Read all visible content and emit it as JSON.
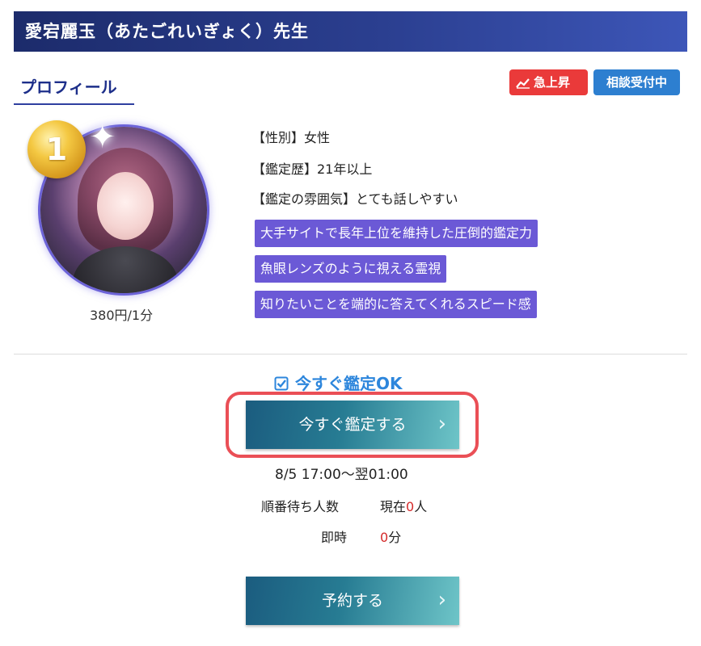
{
  "header": {
    "title": "愛宕麗玉（あたごれいぎょく）先生"
  },
  "profile": {
    "heading": "プロフィール"
  },
  "badges": {
    "rising": "急上昇",
    "accepting": "相談受付中"
  },
  "rank": {
    "number": "1"
  },
  "price": "380円/1分",
  "details": {
    "gender": "【性別】女性",
    "years": "【鑑定歴】21年以上",
    "mood": "【鑑定の雰囲気】とても話しやすい"
  },
  "tags": [
    "大手サイトで長年上位を維持した圧倒的鑑定力",
    "魚眼レンズのように視える霊視",
    "知りたいことを端的に答えてくれるスピード感"
  ],
  "availability": {
    "status": "今すぐ鑑定OK",
    "consult_button": "今すぐ鑑定する",
    "hours": "8/5 17:00〜翌01:00",
    "queue_label": "順番待ち人数",
    "queue_prefix": "現在",
    "queue_count": "0",
    "queue_suffix": "人",
    "wait_label": "即時",
    "wait_count": "0",
    "wait_suffix": "分"
  },
  "reserve_button": "予約する",
  "colors": {
    "header": "#2b3f90",
    "tag": "#6b59d6",
    "rising_badge": "#ea3a3a",
    "accepting_badge": "#2d7fd0",
    "highlight": "#ea4f56",
    "status_text": "#2d86dc"
  },
  "icons": {
    "rising": "trend-up-icon",
    "status": "checkbox-checked-icon",
    "chevron": "chevron-right-icon"
  }
}
